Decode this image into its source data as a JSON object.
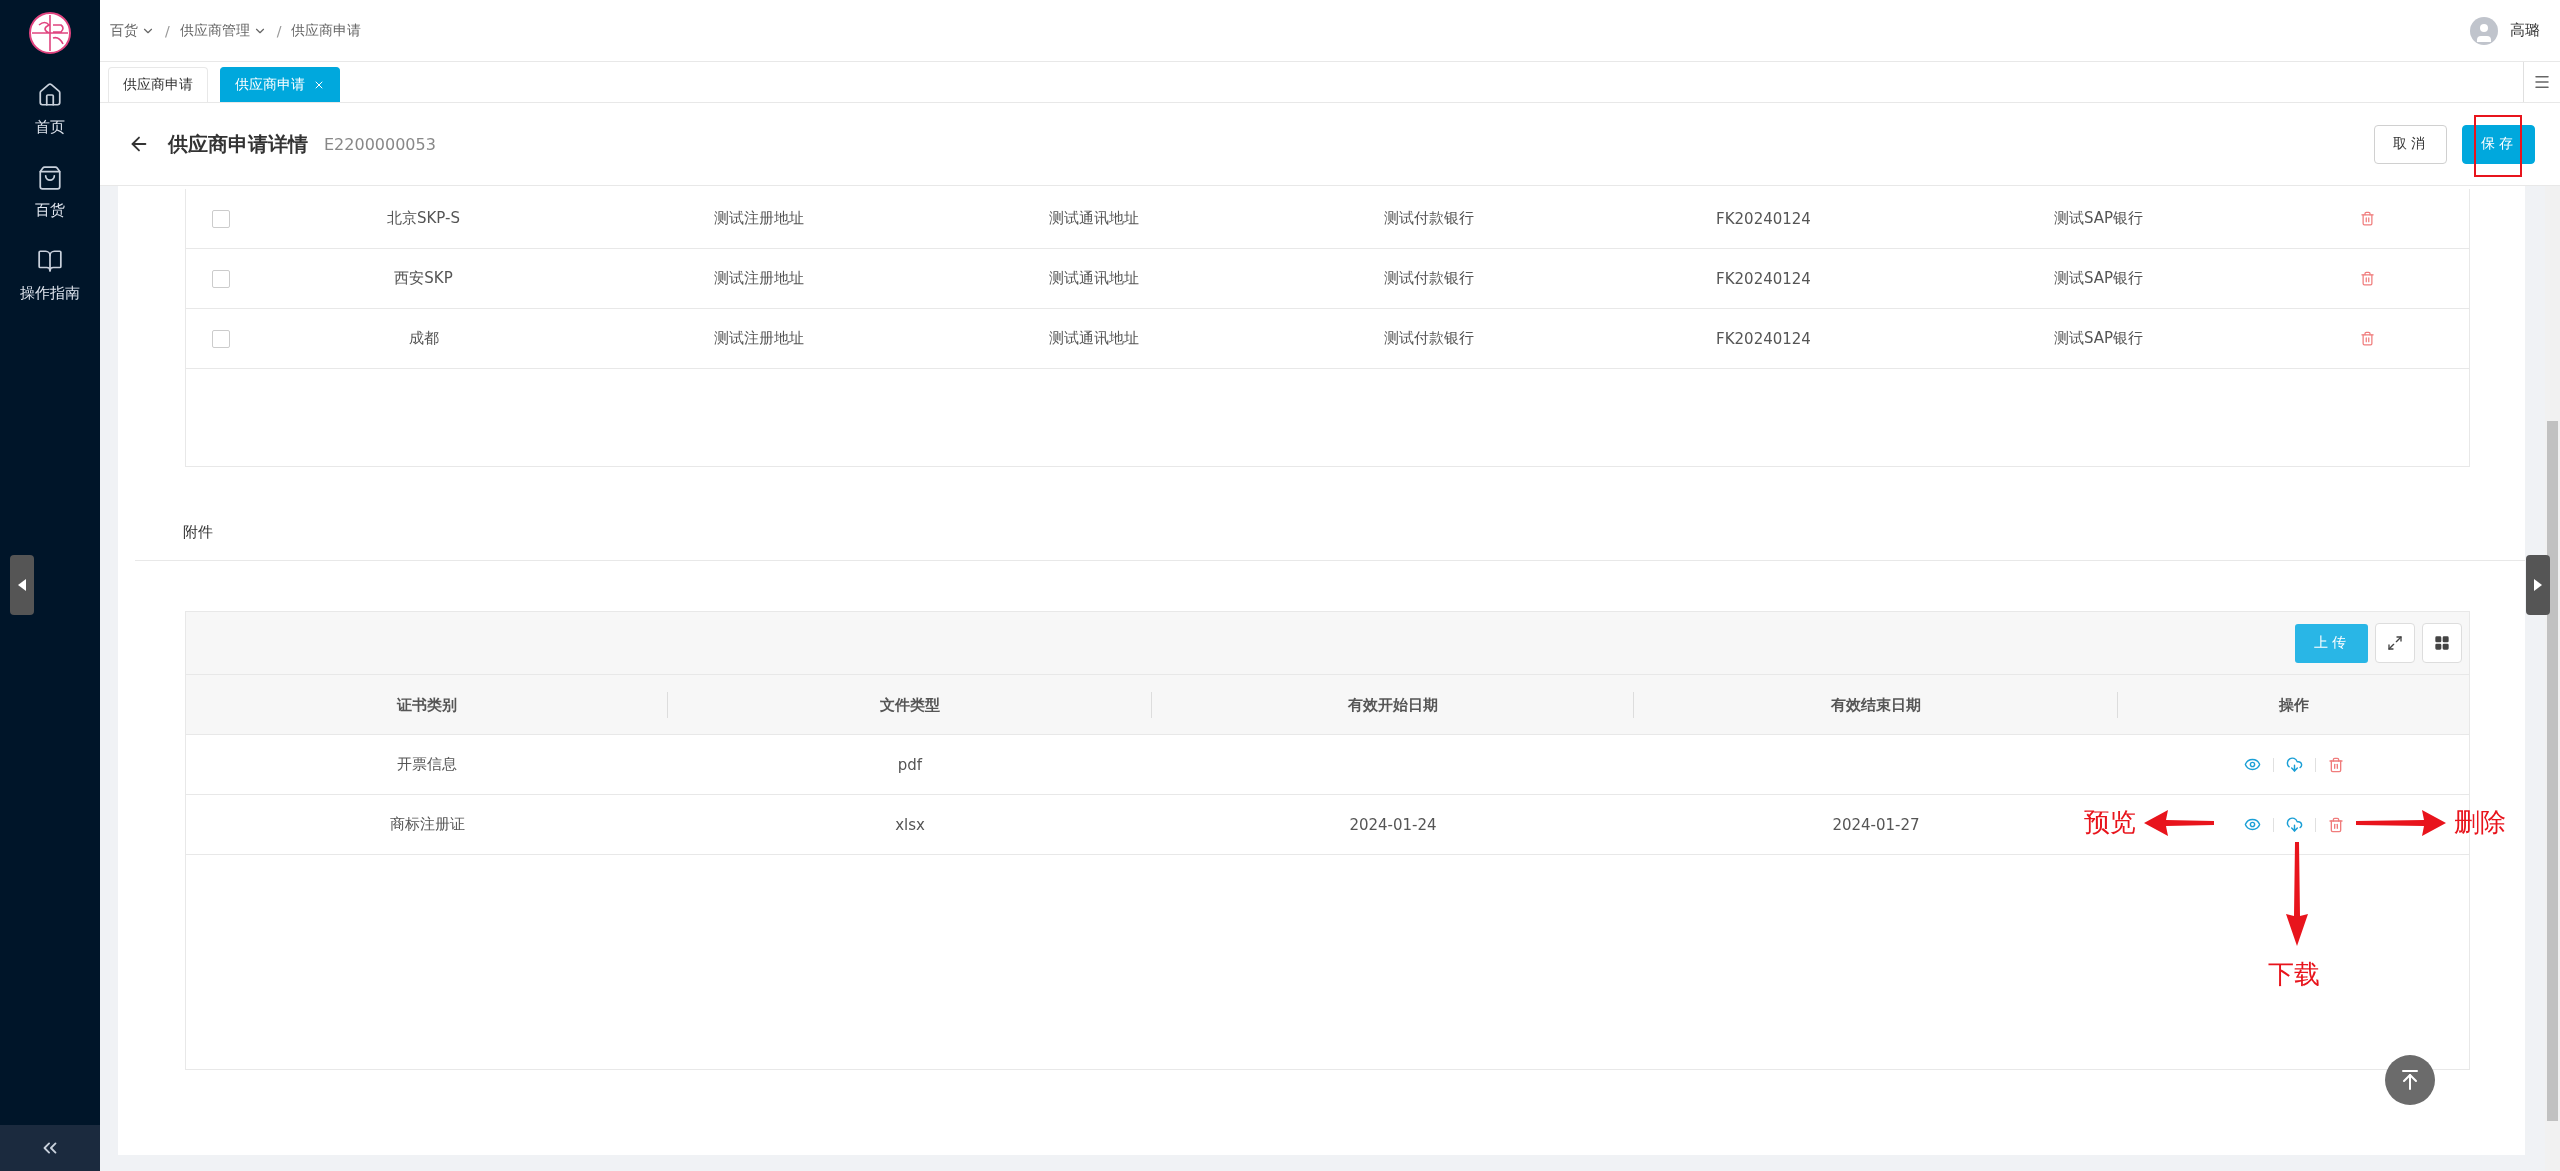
{
  "sidebar": {
    "items": [
      {
        "label": "首页"
      },
      {
        "label": "百货"
      },
      {
        "label": "操作指南"
      }
    ]
  },
  "breadcrumb": [
    {
      "label": "百货",
      "dropdown": true
    },
    {
      "separator": "/",
      "label": "供应商管理",
      "dropdown": true
    },
    {
      "separator": "/",
      "label": "供应商申请",
      "dropdown": false
    }
  ],
  "user": {
    "name": "高璐"
  },
  "tabs": [
    {
      "label": "供应商申请",
      "selected": false,
      "closable": false
    },
    {
      "label": "供应商申请",
      "selected": true,
      "closable": true
    }
  ],
  "page": {
    "title": "供应商申请详情",
    "code": "E2200000053",
    "buttons": [
      {
        "label": "取消",
        "kind": "default",
        "highlighted": false
      },
      {
        "label": "保存",
        "kind": "primary",
        "highlighted": true
      }
    ]
  },
  "bank_table": {
    "rows": [
      {
        "checked": false,
        "cells": [
          "北京SKP-S",
          "测试注册地址",
          "测试通讯地址",
          "测试付款银行",
          "FK20240124",
          "测试SAP银行"
        ]
      },
      {
        "checked": false,
        "cells": [
          "西安SKP",
          "测试注册地址",
          "测试通讯地址",
          "测试付款银行",
          "FK20240124",
          "测试SAP银行"
        ]
      },
      {
        "checked": false,
        "cells": [
          "成都",
          "测试注册地址",
          "测试通讯地址",
          "测试付款银行",
          "FK20240124",
          "测试SAP银行"
        ]
      }
    ]
  },
  "attachments": {
    "title": "附件",
    "upload": "上传",
    "columns": [
      "证书类别",
      "文件类型",
      "有效开始日期",
      "有效结束日期",
      "操作"
    ],
    "rows": [
      {
        "cells": [
          "开票信息",
          "pdf",
          "",
          ""
        ]
      },
      {
        "cells": [
          "商标注册证",
          "xlsx",
          "2024-01-24",
          "2024-01-27"
        ]
      }
    ]
  },
  "annotations": [
    {
      "label": "预览"
    },
    {
      "label": "下载"
    },
    {
      "label": "删除"
    }
  ]
}
